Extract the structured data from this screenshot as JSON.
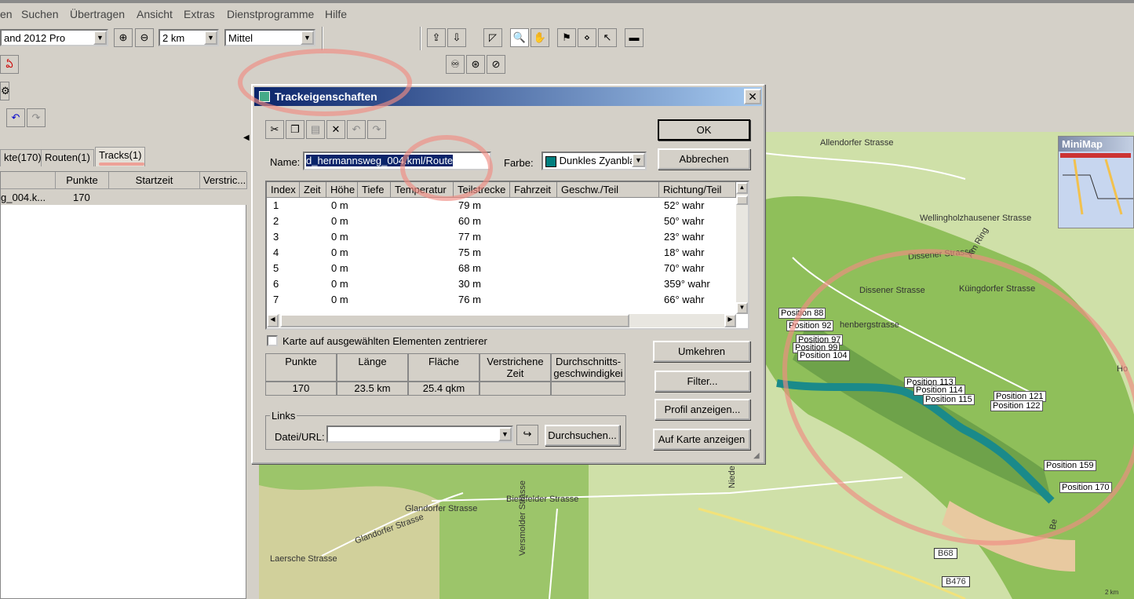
{
  "menu": {
    "items": [
      "en",
      "Suchen",
      "Übertragen",
      "Ansicht",
      "Extras",
      "Dienstprogramme",
      "Hilfe"
    ]
  },
  "toolbar": {
    "map_product": "and 2012 Pro",
    "zoom_value": "2 km",
    "detail_value": "Mittel"
  },
  "left_panel": {
    "tabs": [
      "kte(170)",
      "Routen(1)",
      "Tracks(1)"
    ],
    "columns": [
      "Punkte",
      "Startzeit",
      "Verstric..."
    ],
    "row": {
      "name": "g_004.k...",
      "points": "170"
    }
  },
  "dialog": {
    "title": "Trackeigenschaften",
    "name_label": "Name:",
    "name_value": "d_hermannsweg_004.kml/Route",
    "color_label": "Farbe:",
    "color_value": "Dunkles Zyanbla",
    "color_swatch": "#007f7f",
    "ok": "OK",
    "cancel": "Abbrechen",
    "reverse": "Umkehren",
    "filter": "Filter...",
    "profile": "Profil anzeigen...",
    "show_on_map": "Auf Karte anzeigen",
    "columns": [
      "Index",
      "Zeit",
      "Höhe",
      "Tiefe",
      "Temperatur",
      "Teilstrecke",
      "Fahrzeit",
      "Geschw./Teil",
      "Richtung/Teil"
    ],
    "rows": [
      [
        "1",
        "0 m",
        "79 m",
        "52° wahr"
      ],
      [
        "2",
        "0 m",
        "60 m",
        "50° wahr"
      ],
      [
        "3",
        "0 m",
        "77 m",
        "23° wahr"
      ],
      [
        "4",
        "0 m",
        "75 m",
        "18° wahr"
      ],
      [
        "5",
        "0 m",
        "68 m",
        "70° wahr"
      ],
      [
        "6",
        "0 m",
        "30 m",
        "359° wahr"
      ],
      [
        "7",
        "0 m",
        "76 m",
        "66° wahr"
      ]
    ],
    "center_checkbox": "Karte auf ausgewählten Elementen zentrierer",
    "stats_headers": [
      "Punkte",
      "Länge",
      "Fläche",
      "Verstrichene Zeit",
      "Durchschnitts-geschwindigkeit"
    ],
    "stats_values": [
      "170",
      "23.5 km",
      "25.4 qkm",
      "",
      ""
    ],
    "links_label": "Links",
    "file_label": "Datei/URL:",
    "browse": "Durchsuchen..."
  },
  "map": {
    "minimap": "MiniMap",
    "scale": "2 km",
    "streets": [
      "Allendorfer Strasse",
      "Wellingholzhausener Strasse",
      "Dissener Strasse",
      "Dissener Strasse",
      "Küingdorfer Strasse",
      "Am Ring",
      "henbergstrasse",
      "Bielefelder Strasse",
      "Glandorfer Strasse",
      "Glandorfer Strasse",
      "Laersche Strasse",
      "Versmolder Strasse",
      "B68",
      "B476",
      "Niede",
      "asse",
      "Ho",
      "Be"
    ],
    "positions": [
      "Position 88",
      "Position 92",
      "Position 97",
      "Position 99",
      "Position 104",
      "Position 113",
      "Position 114",
      "Position 115",
      "Position 121",
      "Position 122",
      "Position 159",
      "Position 170"
    ],
    "colors": {
      "map_bg": "#cfe0a8",
      "forest": "#8fbf5a",
      "track": "#1a8a8a",
      "annotation": "#f08c82"
    }
  }
}
